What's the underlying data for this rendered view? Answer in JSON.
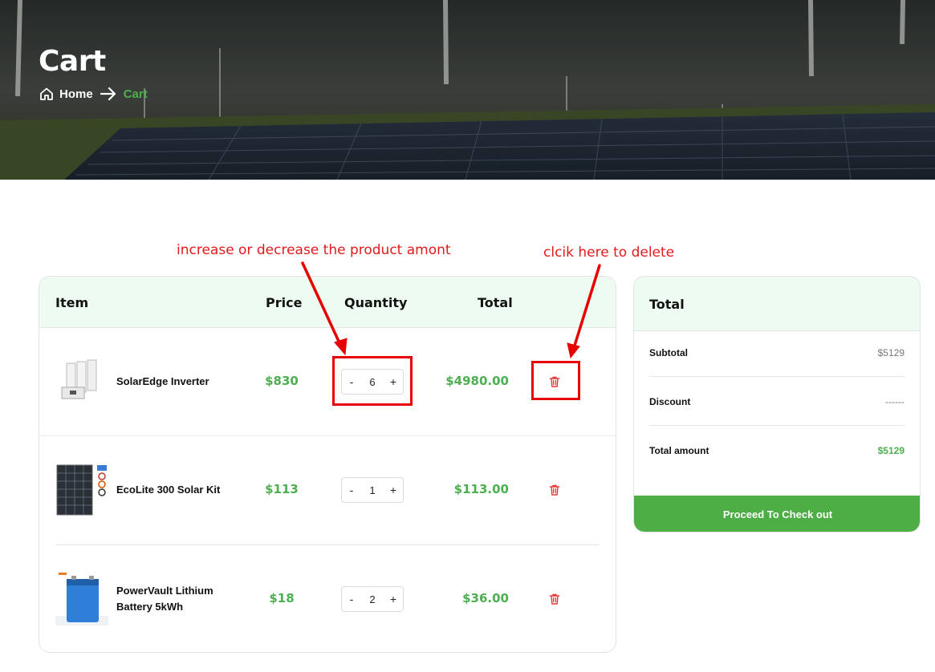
{
  "hero": {
    "title": "Cart",
    "breadcrumb": {
      "home": "Home",
      "current": "Cart"
    }
  },
  "annotations": {
    "quantity_note": "increase or decrease the product amont",
    "delete_note": "clcik here to delete"
  },
  "cart": {
    "columns": {
      "item": "Item",
      "price": "Price",
      "quantity": "Quantity",
      "total": "Total"
    },
    "items": [
      {
        "name": "SolarEdge Inverter",
        "price": "$830",
        "quantity": "6",
        "total": "$4980.00",
        "minus": "-",
        "plus": "+"
      },
      {
        "name": "EcoLite 300 Solar Kit",
        "price": "$113",
        "quantity": "1",
        "total": "$113.00",
        "minus": "-",
        "plus": "+"
      },
      {
        "name": "PowerVault Lithium Battery 5kWh",
        "price": "$18",
        "quantity": "2",
        "total": "$36.00",
        "minus": "-",
        "plus": "+"
      }
    ]
  },
  "summary": {
    "title": "Total",
    "subtotal_label": "Subtotal",
    "subtotal_value": "$5129",
    "discount_label": "Discount",
    "discount_value": "------",
    "total_label": "Total amount",
    "total_value": "$5129",
    "checkout_label": "Proceed To Check out"
  },
  "colors": {
    "accent_green": "#4caf50",
    "header_tint": "#eefbf0",
    "annotation_red": "#e60000",
    "delete_icon": "#e53935"
  },
  "icons": {
    "home": "home-icon",
    "arrow": "arrow-right-icon",
    "delete": "trash-icon"
  }
}
